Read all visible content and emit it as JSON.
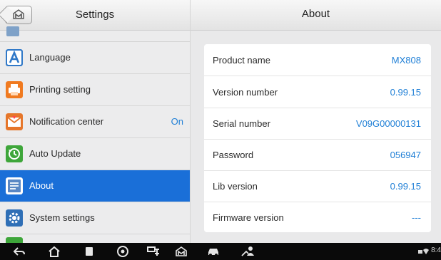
{
  "left_panel": {
    "title": "Settings",
    "items": [
      {
        "label": "Language",
        "icon": "language-icon",
        "color": "#2f78c8"
      },
      {
        "label": "Printing setting",
        "icon": "printer-icon",
        "color": "#f07a20"
      },
      {
        "label": "Notification center",
        "icon": "notification-icon",
        "color": "#e6762a",
        "value": "On"
      },
      {
        "label": "Auto Update",
        "icon": "auto-update-icon",
        "color": "#3ea63a"
      },
      {
        "label": "About",
        "icon": "about-icon",
        "color": "#1a6fd8",
        "active": true
      },
      {
        "label": "System settings",
        "icon": "system-settings-icon",
        "color": "#2f6fb6"
      }
    ]
  },
  "right_panel": {
    "title": "About",
    "rows": [
      {
        "key": "Product name",
        "value": "MX808"
      },
      {
        "key": "Version number",
        "value": "0.99.15"
      },
      {
        "key": "Serial number",
        "value": "V09G00000131"
      },
      {
        "key": "Password",
        "value": "056947"
      },
      {
        "key": "Lib version",
        "value": "0.99.15"
      },
      {
        "key": "Firmware version",
        "value": "---"
      }
    ]
  },
  "status_bar": {
    "time": "8:4"
  },
  "colors": {
    "accent": "#1a6fd8",
    "value_text": "#1f7fd6"
  }
}
